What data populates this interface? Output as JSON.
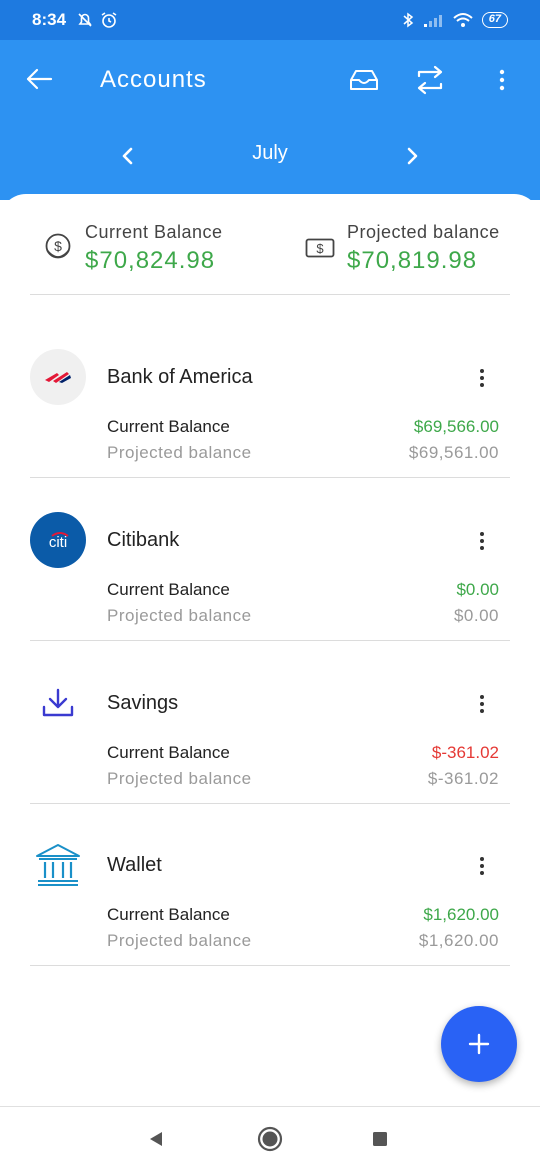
{
  "status_bar": {
    "time": "8:34",
    "battery": "67"
  },
  "app_bar": {
    "title": "Accounts"
  },
  "month_nav": {
    "month": "July"
  },
  "summary": {
    "current": {
      "label": "Current Balance",
      "value": "$70,824.98",
      "icon_text": "$"
    },
    "projected": {
      "label": "Projected balance",
      "value": "$70,819.98",
      "icon_text": "$"
    }
  },
  "accounts": [
    {
      "name": "Bank of America",
      "logo": "bank-of-america-logo",
      "current_label": "Current Balance",
      "current_value": "$69,566.00",
      "current_color": "#3ea84a",
      "projected_label": "Projected balance",
      "projected_value": "$69,561.00"
    },
    {
      "name": "Citibank",
      "logo": "citi-logo",
      "logo_text": "citi",
      "current_label": "Current Balance",
      "current_value": "$0.00",
      "current_color": "#3ea84a",
      "projected_label": "Projected balance",
      "projected_value": "$0.00"
    },
    {
      "name": "Savings",
      "logo": "download-icon",
      "current_label": "Current Balance",
      "current_value": "$-361.02",
      "current_color": "#e53935",
      "projected_label": "Projected balance",
      "projected_value": "$-361.02"
    },
    {
      "name": "Wallet",
      "logo": "bank-building-icon",
      "current_label": "Current Balance",
      "current_value": "$1,620.00",
      "current_color": "#3ea84a",
      "projected_label": "Projected balance",
      "projected_value": "$1,620.00"
    }
  ],
  "colors": {
    "status_bar": "#1e7ae0",
    "app_bar": "#2d92f2",
    "positive": "#3ea84a",
    "negative": "#e53935",
    "fab": "#2962f5"
  }
}
